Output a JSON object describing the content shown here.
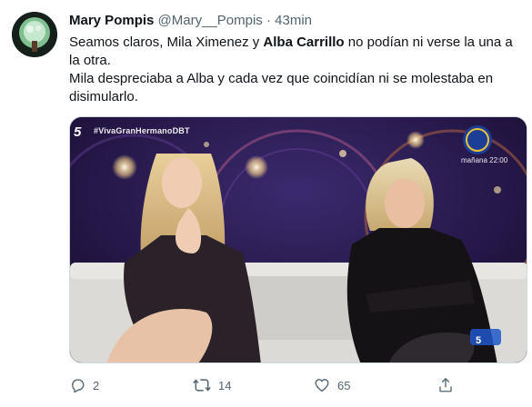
{
  "tweet": {
    "author_name": "Mary Pompis",
    "handle": "@Mary__Pompis",
    "separator": "·",
    "time": "43min",
    "text_line1_a": "Seamos claros, Mila Ximenez y ",
    "text_line1_bold": "Alba Carrillo",
    "text_line1_b": " no podían ni verse la una a la otra.",
    "text_line2": "Mila despreciaba a Alba y cada vez que coincidían ni se molestaba en disimularlo."
  },
  "media": {
    "channel_logo": "5",
    "hashtag": "#VivaGranHermanoDBT",
    "show_time": "mañana 22:00",
    "watermark": "5"
  },
  "actions": {
    "reply_count": "2",
    "retweet_count": "14",
    "like_count": "65"
  },
  "icons": [
    "reply-icon",
    "retweet-icon",
    "like-icon",
    "share-icon"
  ],
  "colors": {
    "text": "#0f1419",
    "secondary": "#536471",
    "border": "#cfd9de"
  }
}
